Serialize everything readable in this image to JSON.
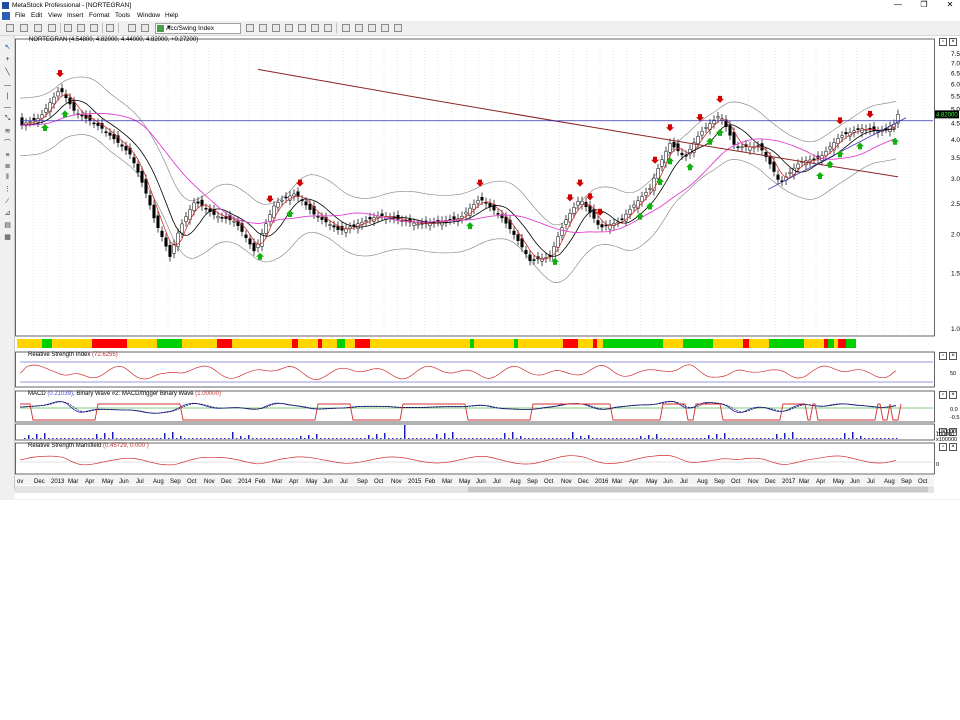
{
  "window": {
    "title": "MetaStock Professional - [NORTEGRAN]",
    "minimize": "—",
    "restore": "❐",
    "close": "✕"
  },
  "menu": [
    "File",
    "Edit",
    "View",
    "Insert",
    "Format",
    "Tools",
    "Window",
    "Help"
  ],
  "toolbar": {
    "expert_combo": "Acc/Swing Index"
  },
  "panes": {
    "price": {
      "symbol": "NORTEGRAN",
      "ohlc": "(4.54800, 4.82000, 4.44000, 4.82000, +0.27200)",
      "last_price_tag": "4.82000",
      "axis": [
        "7.5",
        "7.0",
        "6.5",
        "6.0",
        "5.5",
        "5.0",
        "4.5",
        "4.0",
        "3.5",
        "3.0",
        "2.5",
        "2.0",
        "1.5",
        "1.0"
      ]
    },
    "rsi": {
      "label": "Relative Strength Index",
      "value": "(72.6255)",
      "axis": [
        "50"
      ]
    },
    "macd": {
      "label": "MACD",
      "value": "(0.21039)",
      "label2": ", Binary Wave #2: MACD/trigger Binary Wave",
      "value2": "(1.00000)",
      "axis": [
        "0.0",
        "-0.5"
      ]
    },
    "volume": {
      "axis": [
        "100000",
        "-100000",
        "x100000"
      ]
    },
    "rs_mansfield": {
      "label": "Relative Strength Mansfield",
      "value": "(0.45729, 0.000 )",
      "axis": [
        "0"
      ]
    }
  },
  "x_axis": [
    "ov",
    "Dec",
    "2013",
    "Mar",
    "Apr",
    "May",
    "Jun",
    "Jul",
    "Aug",
    "Sep",
    "Oct",
    "Nov",
    "Dec",
    "2014",
    "Feb",
    "Mar",
    "Apr",
    "May",
    "Jun",
    "Jul",
    "Sep",
    "Oct",
    "Nov",
    "2015",
    "Feb",
    "Mar",
    "May",
    "Jun",
    "Jul",
    "Aug",
    "Sep",
    "Oct",
    "Nov",
    "Dec",
    "2016",
    "Mar",
    "Apr",
    "May",
    "Jun",
    "Jul",
    "Aug",
    "Sep",
    "Oct",
    "Nov",
    "Dec",
    "2017",
    "Mar",
    "Apr",
    "May",
    "Jun",
    "Jul",
    "Aug",
    "Sep",
    "Oct"
  ],
  "colors": {
    "candle": "#000000",
    "sma_black": "#000000",
    "sma_red": "#d03030",
    "sma_magenta": "#e040d0",
    "sma_brown": "#8b2323",
    "bollinger": "#909090",
    "horizontal": "#3030b0",
    "up_arrow": "#10b010",
    "down_arrow": "#d00000",
    "bar_red": "#ff0000",
    "bar_yellow": "#ffd400",
    "bar_green": "#00d000"
  }
}
